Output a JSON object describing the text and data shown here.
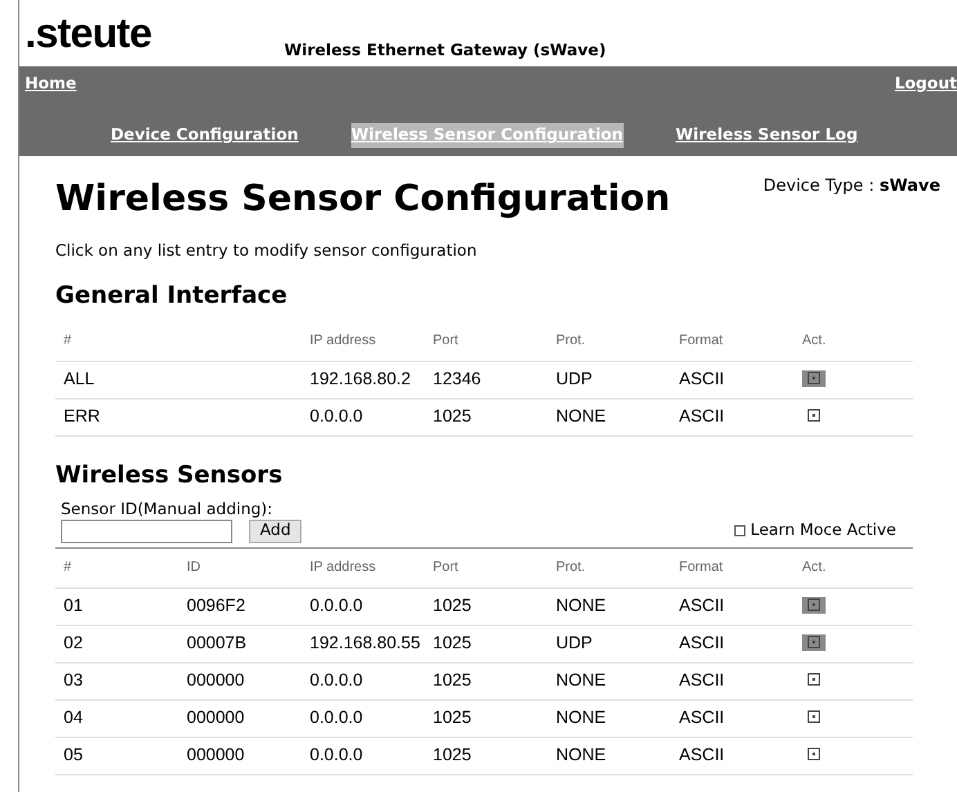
{
  "header": {
    "logo": ".steute",
    "title": "Wireless Ethernet Gateway (sWave)"
  },
  "nav": {
    "home": "Home",
    "logout": "Logout",
    "tabs": [
      {
        "label": "Device Configuration",
        "selected": false
      },
      {
        "label": "Wireless Sensor Configuration",
        "selected": true
      },
      {
        "label": "Wireless Sensor Log",
        "selected": false
      }
    ]
  },
  "page": {
    "title": "Wireless Sensor Configuration",
    "device_type_label": "Device Type :",
    "device_type": "sWave",
    "hint": "Click on any list entry to modify sensor configuration"
  },
  "general_interface": {
    "title": "General Interface",
    "columns": [
      "#",
      "IP address",
      "Port",
      "Prot.",
      "Format",
      "Act."
    ],
    "rows": [
      {
        "cells": [
          "ALL",
          "192.168.80.2",
          "12346",
          "UDP",
          "ASCII"
        ],
        "active": true
      },
      {
        "cells": [
          "ERR",
          "0.0.0.0",
          "1025",
          "NONE",
          "ASCII"
        ],
        "active": false
      }
    ]
  },
  "wireless_sensors": {
    "title": "Wireless Sensors",
    "manual_label": "Sensor ID(Manual adding):",
    "add_button": "Add",
    "learn_mode": {
      "checked": false,
      "label": "Learn Moce Active"
    },
    "columns": [
      "#",
      "ID",
      "IP address",
      "Port",
      "Prot.",
      "Format",
      "Act."
    ],
    "rows": [
      {
        "cells": [
          "01",
          "0096F2",
          "0.0.0.0",
          "1025",
          "NONE",
          "ASCII"
        ],
        "active": true
      },
      {
        "cells": [
          "02",
          "00007B",
          "192.168.80.55",
          "1025",
          "UDP",
          "ASCII"
        ],
        "active": true
      },
      {
        "cells": [
          "03",
          "000000",
          "0.0.0.0",
          "1025",
          "NONE",
          "ASCII"
        ],
        "active": false
      },
      {
        "cells": [
          "04",
          "000000",
          "0.0.0.0",
          "1025",
          "NONE",
          "ASCII"
        ],
        "active": false
      },
      {
        "cells": [
          "05",
          "000000",
          "0.0.0.0",
          "1025",
          "NONE",
          "ASCII"
        ],
        "active": false
      }
    ]
  }
}
